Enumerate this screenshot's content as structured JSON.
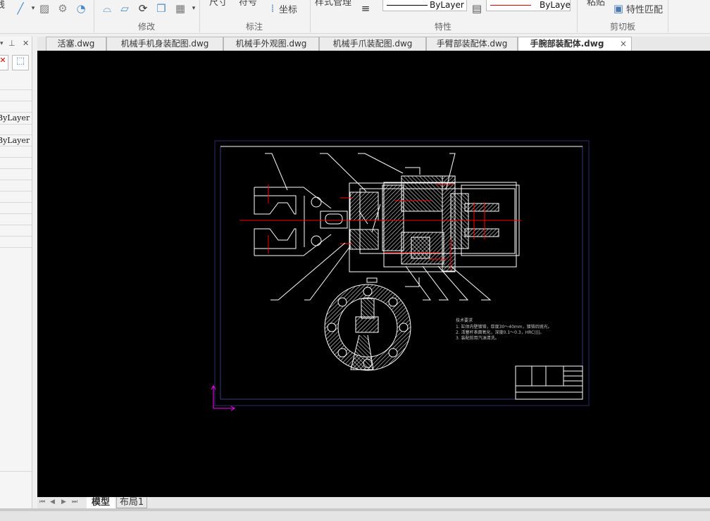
{
  "ribbon": {
    "partial_left_label": "线",
    "groups": [
      {
        "label": "修改"
      },
      {
        "label": "标注",
        "buttons": [
          "尺寸",
          "符号",
          "坐标"
        ]
      },
      {
        "label": "特性",
        "buttons": [
          "样式管理"
        ],
        "linetype_value": "ByLayer",
        "lineweight_value": "ByLaye"
      },
      {
        "label": "剪切板",
        "buttons": [
          "粘贴",
          "特性匹配"
        ]
      }
    ]
  },
  "tabs": [
    {
      "label": "活塞.dwg",
      "active": false
    },
    {
      "label": "机械手机身装配图.dwg",
      "active": false
    },
    {
      "label": "机械手外观图.dwg",
      "active": false
    },
    {
      "label": "机械手爪装配图.dwg",
      "active": false
    },
    {
      "label": "手臂部装配体.dwg",
      "active": false
    },
    {
      "label": "手腕部装配体.dwg",
      "active": true
    }
  ],
  "tab_close": "×",
  "left_panel": {
    "pin": "ᚹ",
    "close": "✕",
    "values": [
      "ByLayer",
      "ByLayer"
    ]
  },
  "drawing": {
    "tech_title": "技术要求",
    "tech_lines": [
      "1. 缸体内壁镀铬，厚度30～40mm，镀铬后抛光。",
      "2. 活塞杆表面氧化，深度0.1～0.3，HRC||||。",
      "3. 装配前用汽油清洗。"
    ]
  },
  "layout_tabs": [
    {
      "label": "模型",
      "active": true
    },
    {
      "label": "布局1",
      "active": false
    }
  ],
  "colors": {
    "canvas": "#000000",
    "centerline": "#ff0000",
    "ucs": "#ff00ff",
    "frame": "#2a2a70"
  }
}
